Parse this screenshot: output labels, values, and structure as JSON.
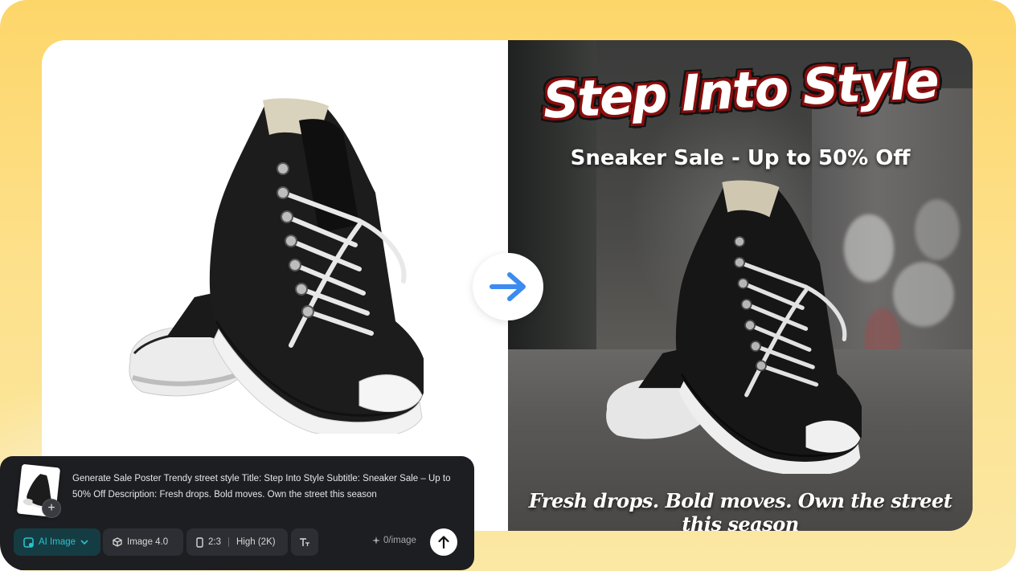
{
  "poster": {
    "title": "Step Into Style",
    "subtitle": "Sneaker Sale - Up to 50% Off",
    "description": "Fresh drops. Bold moves. Own the street this season"
  },
  "prompt": {
    "text": "Generate Sale Poster Trendy street style Title: Step Into Style Subtitle: Sneaker Sale – Up to 50% Off Description: Fresh drops. Bold moves. Own the street this season",
    "add_symbol": "+"
  },
  "toolbar": {
    "mode_label": "AI Image",
    "model_label": "Image 4.0",
    "ratio_label": "2:3",
    "quality_label": "High (2K)",
    "credits_label": "0/image"
  },
  "colors": {
    "frame_yellow": "#fdd66a",
    "arrow_blue": "#3b8bf0",
    "ai_chip_text": "#29c2cc",
    "panel_bg": "#1d1e22",
    "title_outline": "#8c0d0d"
  },
  "icons": {
    "arrow": "arrow-right-icon",
    "mode": "ai-image-icon",
    "chevron": "chevron-down-icon",
    "model": "cube-icon",
    "ratio": "portrait-ratio-icon",
    "text_style": "text-format-icon",
    "credits": "sparkle-icon",
    "send": "arrow-up-icon"
  }
}
